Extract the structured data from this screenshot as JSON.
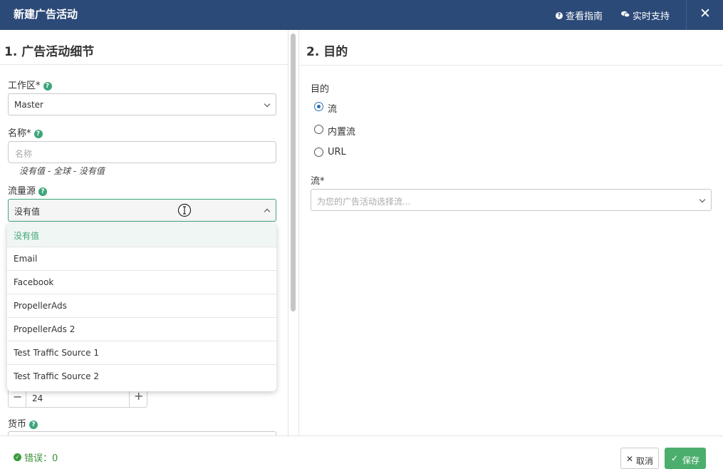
{
  "header": {
    "title": "新建广告活动",
    "guide_label": "查看指南",
    "support_label": "实时支持",
    "close_glyph": "✕"
  },
  "left": {
    "section_title": "1. 广告活动细节",
    "workspace": {
      "label": "工作区*",
      "value": "Master"
    },
    "name": {
      "label": "名称*",
      "placeholder": "名称",
      "hint": "没有值 - 全球 - 没有值"
    },
    "traffic_source": {
      "label": "流量源",
      "value": "没有值",
      "options": [
        "没有值",
        "Email",
        "Facebook",
        "PropellerAds",
        "PropellerAds 2",
        "Test Traffic Source 1",
        "Test Traffic Source 2"
      ]
    },
    "stepper": {
      "value": "24",
      "minus": "−",
      "plus": "+"
    },
    "currency": {
      "label": "货币"
    }
  },
  "right": {
    "section_title": "2. 目的",
    "destination_label": "目的",
    "destinations": [
      {
        "label": "流",
        "selected": true
      },
      {
        "label": "内置流",
        "selected": false
      },
      {
        "label": "URL",
        "selected": false
      }
    ],
    "flow": {
      "label": "流*",
      "placeholder": "为您的广告活动选择流..."
    }
  },
  "footer": {
    "errors_label": "错误：0",
    "cancel_label": "取消",
    "save_label": "保存"
  },
  "colors": {
    "header_bg": "#2c4a78",
    "accent_green": "#3fa67a",
    "radio_blue": "#2c6fb3"
  }
}
